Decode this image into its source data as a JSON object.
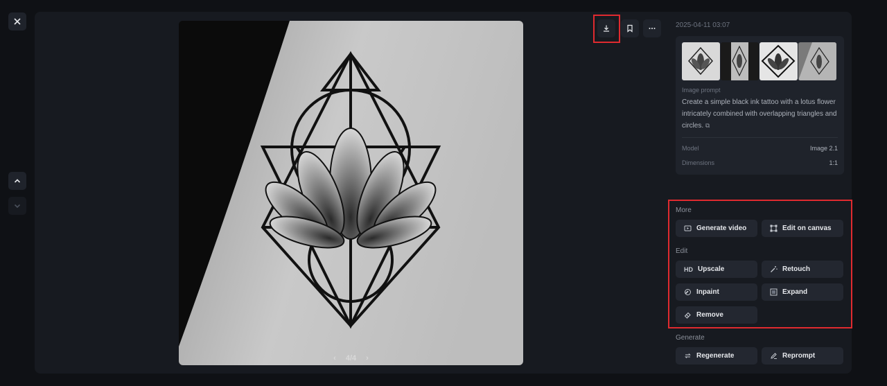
{
  "viewer": {
    "pager": {
      "current_total": "4/4"
    }
  },
  "details": {
    "timestamp": "2025-04-11 03:07",
    "prompt_label": "Image prompt",
    "prompt_text": "Create a simple black ink tattoo with a lotus flower intricately combined with overlapping triangles and circles.",
    "model_label": "Model",
    "model_value": "Image 2.1",
    "dimensions_label": "Dimensions",
    "dimensions_value": "1:1"
  },
  "sections": {
    "more": "More",
    "edit": "Edit",
    "generate": "Generate"
  },
  "actions": {
    "generate_video": "Generate video",
    "edit_on_canvas": "Edit on canvas",
    "upscale": "Upscale",
    "upscale_icon_text": "HD",
    "retouch": "Retouch",
    "inpaint": "Inpaint",
    "expand": "Expand",
    "remove": "Remove",
    "regenerate": "Regenerate",
    "reprompt": "Reprompt"
  },
  "icons": {
    "close": "close-icon",
    "up": "chevron-up-icon",
    "down": "chevron-down-icon",
    "download": "download-icon",
    "bookmark": "bookmark-icon",
    "more": "more-icon"
  },
  "colors": {
    "highlight": "#e02a2f",
    "background": "#0f1115",
    "panel": "#171a20"
  }
}
